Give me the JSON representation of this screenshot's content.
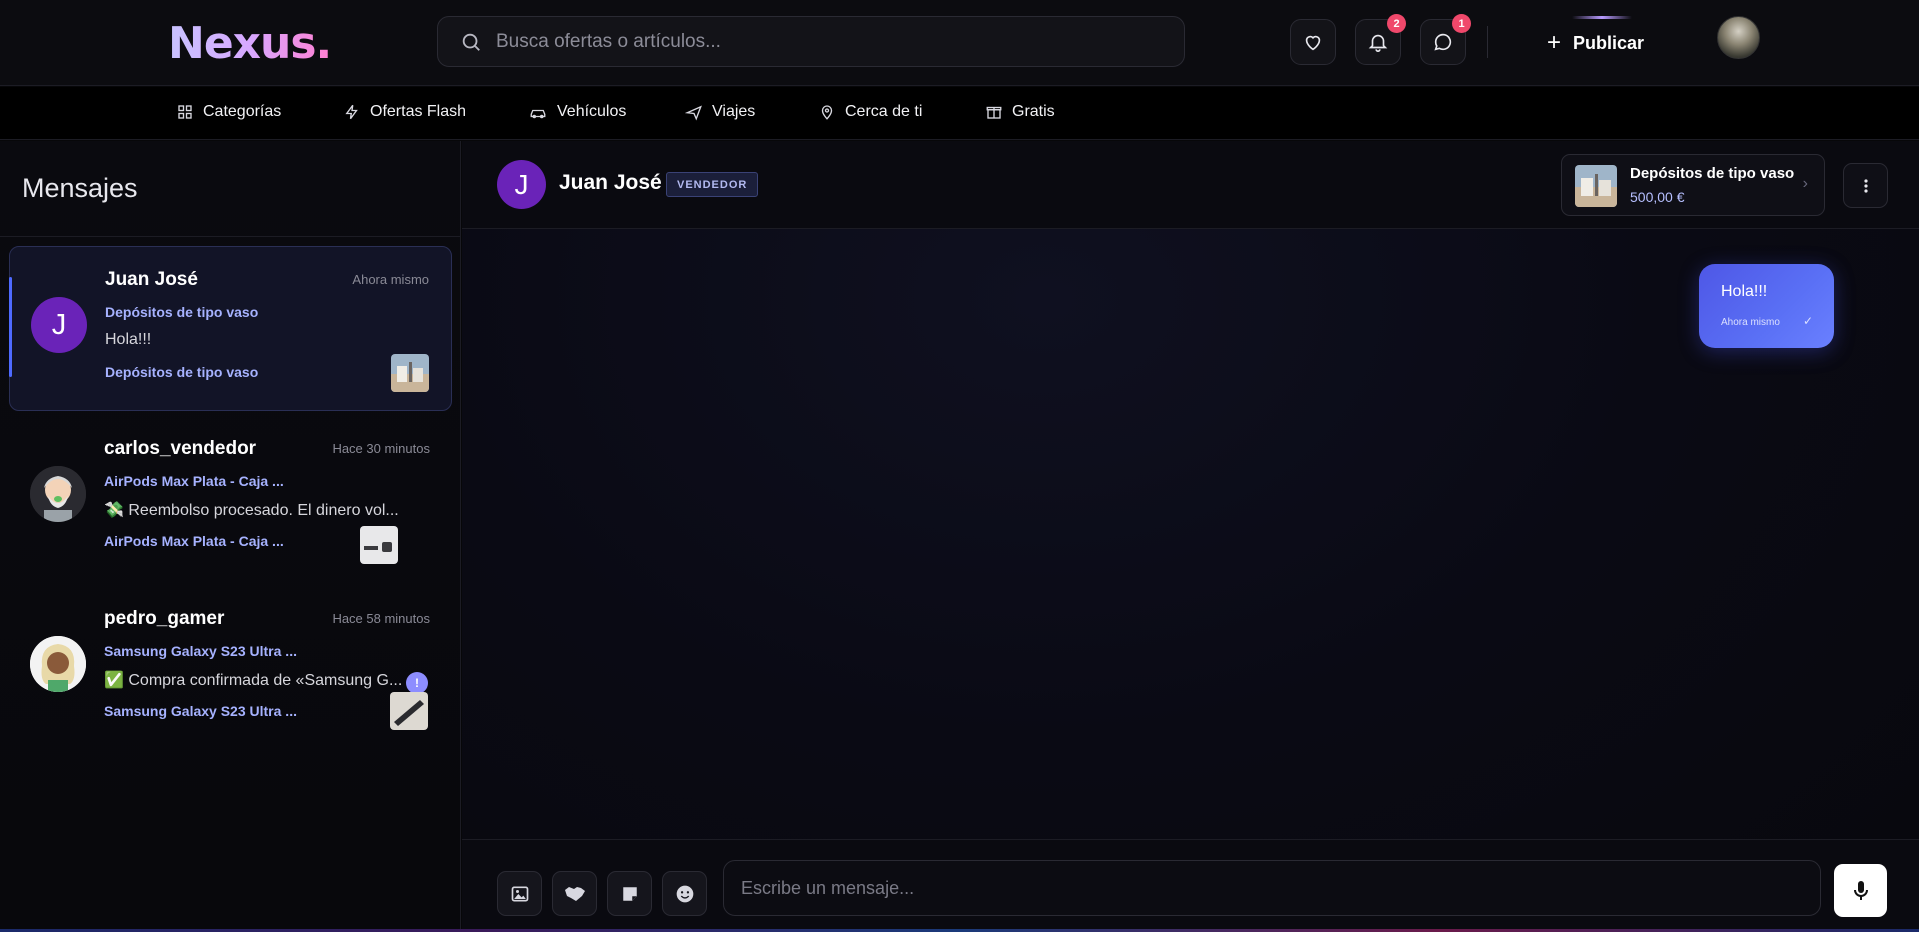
{
  "app": {
    "logo": "Nexus."
  },
  "search": {
    "placeholder": "Busca ofertas o artículos..."
  },
  "header": {
    "notifications_badge": "2",
    "messages_badge": "1",
    "publish_label": "Publicar"
  },
  "categories": [
    {
      "label": "Categorías",
      "icon": "grid-icon"
    },
    {
      "label": "Ofertas Flash",
      "icon": "lightning-icon"
    },
    {
      "label": "Vehículos",
      "icon": "car-icon"
    },
    {
      "label": "Viajes",
      "icon": "plane-icon"
    },
    {
      "label": "Cerca de ti",
      "icon": "map-pin-icon"
    },
    {
      "label": "Gratis",
      "icon": "gift-icon"
    }
  ],
  "sidebar": {
    "title": "Mensajes",
    "conversations": [
      {
        "initial": "J",
        "name": "Juan José",
        "time": "Ahora mismo",
        "product": "Depósitos de tipo vaso",
        "message": "Hola!!!",
        "product_footer": "Depósitos de tipo vaso",
        "unread": ""
      },
      {
        "initial": "",
        "name": "carlos_vendedor",
        "time": "Hace 30 minutos",
        "product": "AirPods Max Plata - Caja ...",
        "message": "💸 Reembolso procesado. El dinero vol...",
        "product_footer": "AirPods Max Plata - Caja ...",
        "unread": "!"
      },
      {
        "initial": "",
        "name": "pedro_gamer",
        "time": "Hace 58 minutos",
        "product": "Samsung Galaxy S23 Ultra ...",
        "message": "✅ Compra confirmada de «Samsung G...",
        "product_footer": "Samsung Galaxy S23 Ultra ...",
        "unread": ""
      }
    ]
  },
  "chat": {
    "avatar_initial": "J",
    "name": "Juan José",
    "role": "VENDEDOR",
    "product": {
      "title": "Depósitos de tipo vaso",
      "price": "500,00 €"
    },
    "messages": [
      {
        "text": "Hola!!!",
        "time": "Ahora mismo",
        "status": "sent"
      }
    ],
    "composer": {
      "placeholder": "Escribe un mensaje..."
    }
  },
  "colors": {
    "accent": "#5a70f5",
    "link": "#a6b2ff",
    "badge": "#f0486b",
    "avatar_purple": "#6a23b8"
  }
}
